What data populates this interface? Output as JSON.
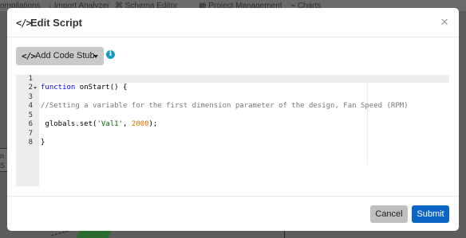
{
  "background": {
    "nav_items": [
      "ompilations",
      "Import Analyzer",
      "Schema Editor",
      "Project Management",
      "Charts"
    ],
    "left_fragment": "n S\nRI"
  },
  "modal": {
    "title": "Edit Script",
    "title_icon": "code-icon",
    "close_label": "×",
    "add_stub_label": "Add Code Stub",
    "info_icon_label": "i"
  },
  "editor": {
    "line_numbers": [
      "1",
      "2",
      "3",
      "4",
      "5",
      "6",
      "7",
      "8"
    ],
    "lines": [
      "",
      "function onStart() {",
      "",
      "//Setting a variable for the first dimension parameter of the design, Fan Speed (RPM)",
      "",
      " globals.set('Val1', 2000);",
      "",
      "}"
    ],
    "tokens": {
      "kw_function": "function",
      "fn_rest": " onStart() {",
      "call_prefix": " globals.set(",
      "string_val": "'Val1'",
      "sep": ", ",
      "number_val": "2000",
      "call_suffix": ");"
    }
  },
  "footer": {
    "cancel_label": "Cancel",
    "submit_label": "Submit"
  },
  "colors": {
    "primary": "#0c66c4",
    "info": "#1a9bc6",
    "keyword": "#0000ff",
    "string": "#036a07",
    "number": "#e07000",
    "comment": "#7a7a7a"
  }
}
